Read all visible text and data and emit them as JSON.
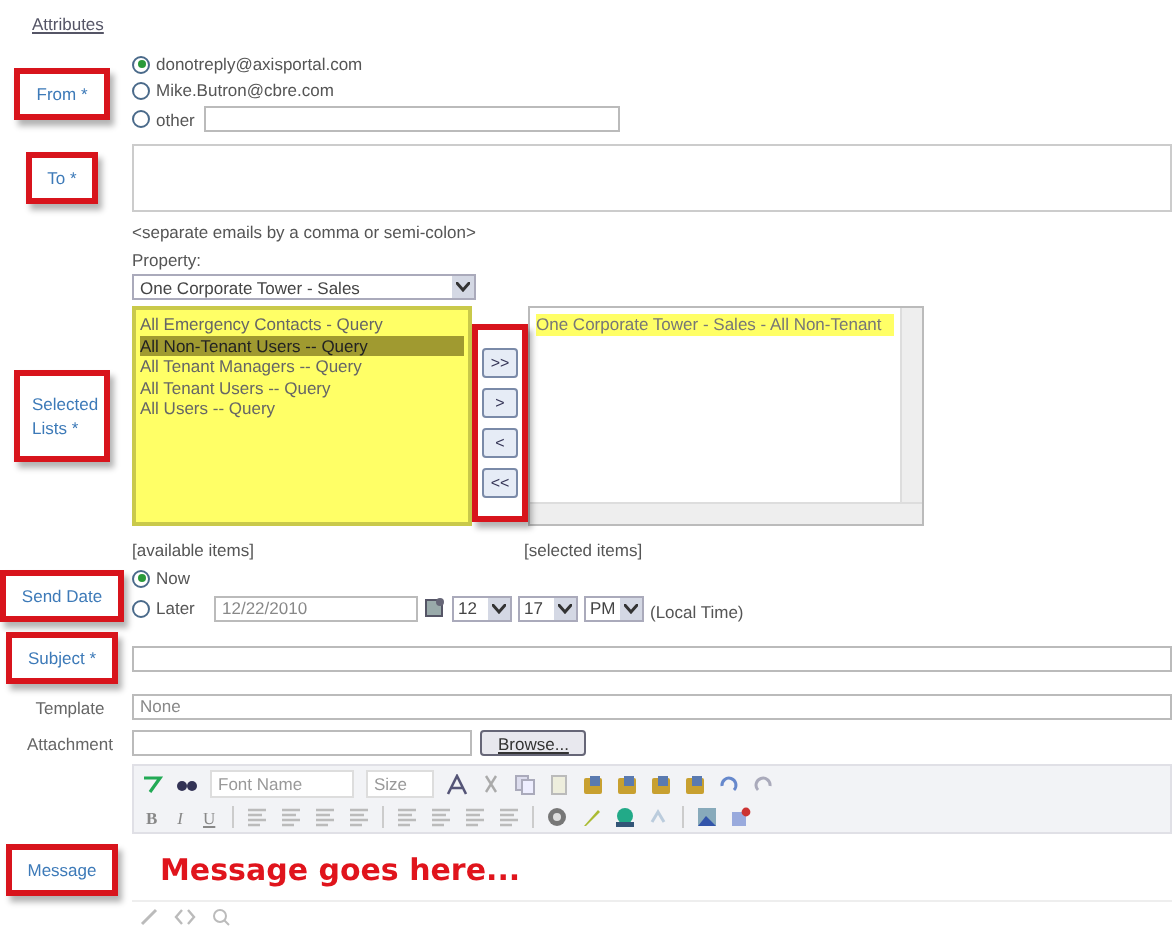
{
  "attributes_link": "Attributes",
  "from": {
    "label": "From *",
    "options": [
      {
        "label": "donotreply@axisportal.com",
        "selected": true
      },
      {
        "label": "Mike.Butron@cbre.com",
        "selected": false
      },
      {
        "label": "other",
        "selected": false
      }
    ]
  },
  "to": {
    "label": "To *",
    "hint": "<separate emails by a comma or semi-colon>"
  },
  "lists": {
    "label": "Selected Lists *",
    "property_label": "Property:",
    "property_value": "One Corporate Tower - Sales",
    "available": [
      {
        "label": "All Emergency Contacts - Query",
        "selected": false
      },
      {
        "label": "All Non-Tenant Users -- Query",
        "selected": true
      },
      {
        "label": "All Tenant Managers -- Query",
        "selected": false
      },
      {
        "label": "All Tenant Users -- Query",
        "selected": false
      },
      {
        "label": "All Users -- Query",
        "selected": false
      }
    ],
    "transfer_buttons": [
      ">>",
      ">",
      "<",
      "<<"
    ],
    "chosen": [
      {
        "label": "One Corporate Tower - Sales - All Non-Tenant",
        "selected": true
      }
    ],
    "available_caption": "[available items]",
    "chosen_caption": "[selected items]"
  },
  "send_date": {
    "label": "Send Date",
    "options": [
      {
        "label": "Now",
        "selected": true
      },
      {
        "label": "Later",
        "selected": false
      }
    ],
    "date": "12/22/2010",
    "hour": "12",
    "minute": "17",
    "ampm": "PM",
    "note": "(Local Time)"
  },
  "subject": {
    "label": "Subject *"
  },
  "template": {
    "label": "Template",
    "value": "None"
  },
  "attachment": {
    "label": "Attachment",
    "button": "Browse..."
  },
  "editor": {
    "font_name": "Font Name",
    "size": "Size",
    "format_buttons": [
      "B",
      "I",
      "U"
    ],
    "label": "Message",
    "content": "Message goes here..."
  }
}
